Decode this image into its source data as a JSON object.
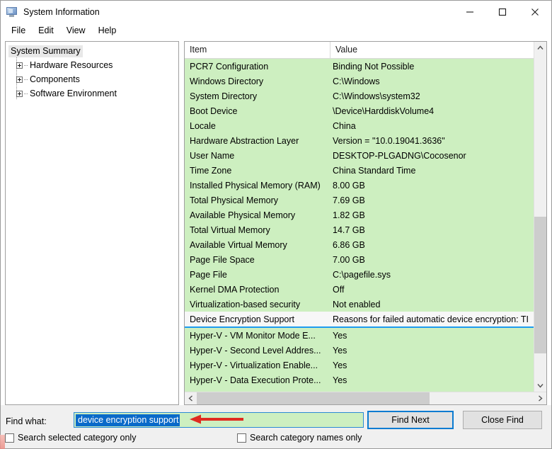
{
  "window": {
    "title": "System Information",
    "icon": "monitor-icon",
    "buttons": {
      "minimize": "minimize-icon",
      "maximize": "maximize-icon",
      "close": "close-icon"
    }
  },
  "menubar": {
    "items": [
      {
        "label": "File"
      },
      {
        "label": "Edit"
      },
      {
        "label": "View"
      },
      {
        "label": "Help"
      }
    ]
  },
  "tree": {
    "root": {
      "label": "System Summary",
      "selected": true
    },
    "children": [
      {
        "label": "Hardware Resources",
        "expander": "plus-icon"
      },
      {
        "label": "Components",
        "expander": "plus-icon"
      },
      {
        "label": "Software Environment",
        "expander": "plus-icon"
      }
    ]
  },
  "list": {
    "columns": [
      {
        "label": "Item"
      },
      {
        "label": "Value"
      }
    ],
    "highlight_color": "#cdefc0",
    "selection_color": "#1d9bf0",
    "rows": [
      {
        "item": "PCR7 Configuration",
        "value": "Binding Not Possible"
      },
      {
        "item": "Windows Directory",
        "value": "C:\\Windows"
      },
      {
        "item": "System Directory",
        "value": "C:\\Windows\\system32"
      },
      {
        "item": "Boot Device",
        "value": "\\Device\\HarddiskVolume4"
      },
      {
        "item": "Locale",
        "value": "China"
      },
      {
        "item": "Hardware Abstraction Layer",
        "value": "Version = \"10.0.19041.3636\""
      },
      {
        "item": "User Name",
        "value": "DESKTOP-PLGADNG\\Cocosenor"
      },
      {
        "item": "Time Zone",
        "value": "China Standard Time"
      },
      {
        "item": "Installed Physical Memory (RAM)",
        "value": "8.00 GB"
      },
      {
        "item": "Total Physical Memory",
        "value": "7.69 GB"
      },
      {
        "item": "Available Physical Memory",
        "value": "1.82 GB"
      },
      {
        "item": "Total Virtual Memory",
        "value": "14.7 GB"
      },
      {
        "item": "Available Virtual Memory",
        "value": "6.86 GB"
      },
      {
        "item": "Page File Space",
        "value": "7.00 GB"
      },
      {
        "item": "Page File",
        "value": "C:\\pagefile.sys"
      },
      {
        "item": "Kernel DMA Protection",
        "value": "Off"
      },
      {
        "item": "Virtualization-based security",
        "value": "Not enabled"
      },
      {
        "item": "Device Encryption Support",
        "value": "Reasons for failed automatic device encryption: TI",
        "selected": true
      },
      {
        "item": "Hyper-V - VM Monitor Mode E...",
        "value": "Yes"
      },
      {
        "item": "Hyper-V - Second Level Addres...",
        "value": "Yes"
      },
      {
        "item": "Hyper-V - Virtualization Enable...",
        "value": "Yes"
      },
      {
        "item": "Hyper-V - Data Execution Prote...",
        "value": "Yes"
      }
    ]
  },
  "scrollbars": {
    "vertical": {
      "up": "chevron-up-icon",
      "down": "chevron-down-icon"
    },
    "horizontal": {
      "left": "chevron-left-icon",
      "right": "chevron-right-icon"
    }
  },
  "find": {
    "label": "Find what:",
    "value": "device encryption support",
    "placeholder": "",
    "find_next_label": "Find Next",
    "close_find_label": "Close Find",
    "checkbox_selected_category": {
      "label": "Search selected category only",
      "checked": false
    },
    "checkbox_category_names": {
      "label": "Search category names only",
      "checked": false
    }
  },
  "annotation": {
    "arrow": "left-pointing-arrow",
    "color": "#e02b20"
  }
}
